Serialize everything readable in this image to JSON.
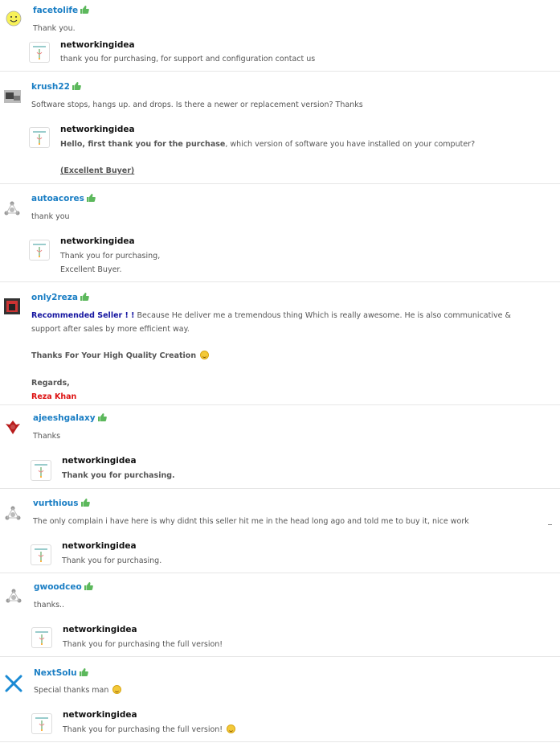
{
  "reviews": [
    {
      "username": "facetolife",
      "avatar": "smiley-face-avatar",
      "text": "Thank you.",
      "reply": {
        "seller": "networkingidea",
        "lines": [
          "thank you for purchasing, for support and configuration contact us"
        ]
      }
    },
    {
      "username": "krush22",
      "avatar": "photo-avatar",
      "text": "Software stops, hangs up. and drops. Is there a newer or replacement version? Thanks",
      "reply": {
        "seller": "networkingidea",
        "bold_part": "Hello, first thank you for the purchase",
        "rest": ", which version of software you have installed on your computer?",
        "tag": "(Excellent Buyer)"
      }
    },
    {
      "username": "autoacores",
      "avatar": "default-avatar",
      "text": "thank you",
      "reply": {
        "seller": "networkingidea",
        "lines": [
          "Thank you for purchasing,",
          "Excellent Buyer."
        ]
      }
    },
    {
      "username": "only2reza",
      "avatar": "photo-avatar",
      "recommended": "Recommended Seller",
      "exclaim": " ! !",
      "text_line1": " Because He deliver me a tremendous thing Which is really awesome. He is also communicative &",
      "text_line2": "support after sales by more efficient way.",
      "thanks": "Thanks For Your High Quality Creation",
      "regards": "Regards,",
      "signature": "Reza Khan"
    },
    {
      "username": "ajeeshgalaxy",
      "avatar": "red-logo-avatar",
      "text": "Thanks",
      "reply": {
        "seller": "networkingidea",
        "lines": [
          "Thank you for purchasing."
        ]
      }
    },
    {
      "username": "vurthious",
      "avatar": "default-avatar",
      "text": "The only complain i have here is why didnt this seller hit me in the head long ago and told me to buy it, nice work",
      "reply": {
        "seller": "networkingidea",
        "lines": [
          "Thank you for purchasing."
        ]
      }
    },
    {
      "username": "gwoodceo",
      "avatar": "default-avatar",
      "text": "thanks..",
      "reply": {
        "seller": "networkingidea",
        "lines": [
          "Thank you for purchasing the full version!"
        ]
      }
    },
    {
      "username": "NextSolu",
      "avatar": "x-logo-avatar",
      "text": "Special thanks man",
      "reply": {
        "seller": "networkingidea",
        "lines": [
          "Thank you for purchasing the full version!"
        ]
      }
    }
  ]
}
